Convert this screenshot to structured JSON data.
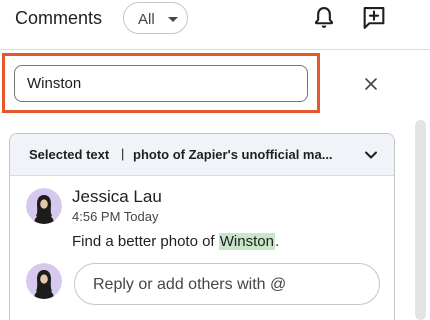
{
  "header": {
    "title": "Comments",
    "filter": {
      "selected": "All"
    },
    "icons": {
      "notifications": "bell-icon",
      "new_comment": "add-comment-icon"
    }
  },
  "search": {
    "value": "Winston",
    "clear_icon": "close-icon",
    "highlight_color": "#e5582d"
  },
  "comment_card": {
    "selected_text_label": "Selected text",
    "separator": "|",
    "selected_text_snippet": "photo of Zapier's unofficial ma...",
    "collapse_icon": "chevron-down-icon",
    "author": "Jessica Lau",
    "timestamp": "4:56 PM Today",
    "body_before": "Find a better photo of ",
    "body_highlight": "Winston",
    "body_after": ".",
    "highlight_color": "#c8e6c9",
    "reply_placeholder": "Reply or add others with @"
  }
}
